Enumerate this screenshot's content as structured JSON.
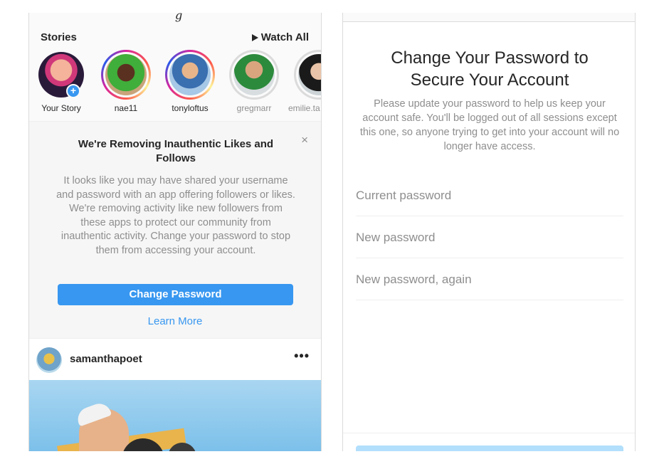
{
  "left_screen": {
    "top_glyph": "g",
    "stories": {
      "title": "Stories",
      "watch_all_label": "Watch All",
      "items": [
        {
          "name": "Your Story",
          "state": "own"
        },
        {
          "name": "nae11",
          "state": "unseen"
        },
        {
          "name": "tonyloftus",
          "state": "unseen"
        },
        {
          "name": "gregmarr",
          "state": "seen"
        },
        {
          "name": "emilie.ta",
          "state": "seen"
        }
      ]
    },
    "notice": {
      "title": "We're Removing Inauthentic Likes and Follows",
      "close_glyph": "×",
      "body": "It looks like you may have shared your username and password with an app offering followers or likes. We're removing activity like new followers from these apps to protect our community from inauthentic activity. Change your password to stop them from accessing your account.",
      "primary_button": "Change Password",
      "secondary_link": "Learn More"
    },
    "post": {
      "username": "samanthapoet",
      "more_glyph": "•••"
    }
  },
  "right_screen": {
    "title": "Change Your Password to Secure Your Account",
    "description": "Please update your password to help us keep your account safe. You'll be logged out of all sessions except this one, so anyone trying to get into your account will no longer have access.",
    "fields": {
      "current_placeholder": "Current password",
      "new_placeholder": "New password",
      "again_placeholder": "New password, again"
    }
  },
  "colors": {
    "accent_blue": "#3897f0",
    "disabled_blue": "#b2dffc",
    "text_primary": "#262626",
    "text_secondary": "#8e8e8e"
  }
}
